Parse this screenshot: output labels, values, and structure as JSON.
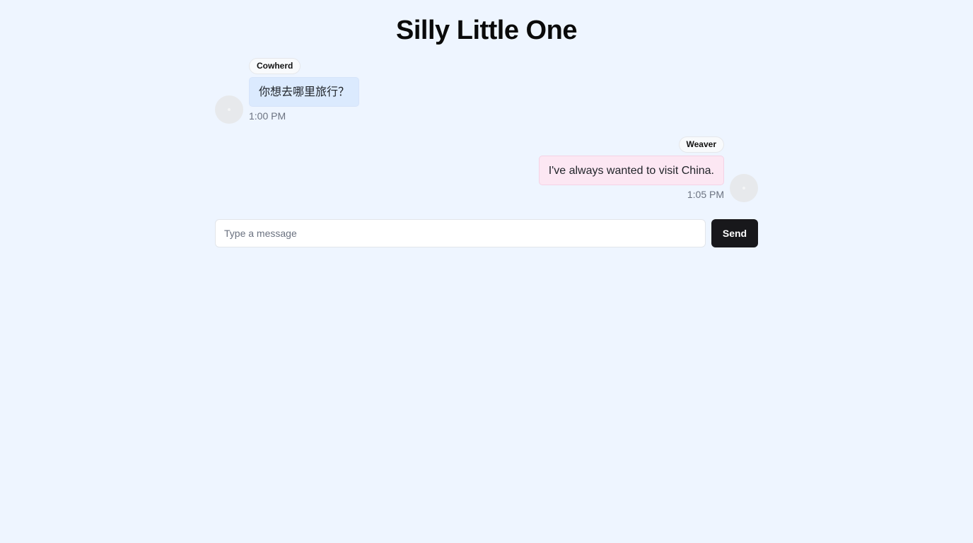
{
  "page": {
    "title": "Silly Little One"
  },
  "messages": [
    {
      "side": "left",
      "sender": "Cowherd",
      "text": "你想去哪里旅行？",
      "time": "1:00 PM",
      "bubble_color": "#dbeafe"
    },
    {
      "side": "right",
      "sender": "Weaver",
      "text": "I've always wanted to visit China.",
      "time": "1:05 PM",
      "bubble_color": "#fce7f3"
    }
  ],
  "composer": {
    "placeholder": "Type a message",
    "value": "",
    "send_label": "Send"
  },
  "colors": {
    "background": "#eef5ff",
    "send_button": "#18181b"
  }
}
